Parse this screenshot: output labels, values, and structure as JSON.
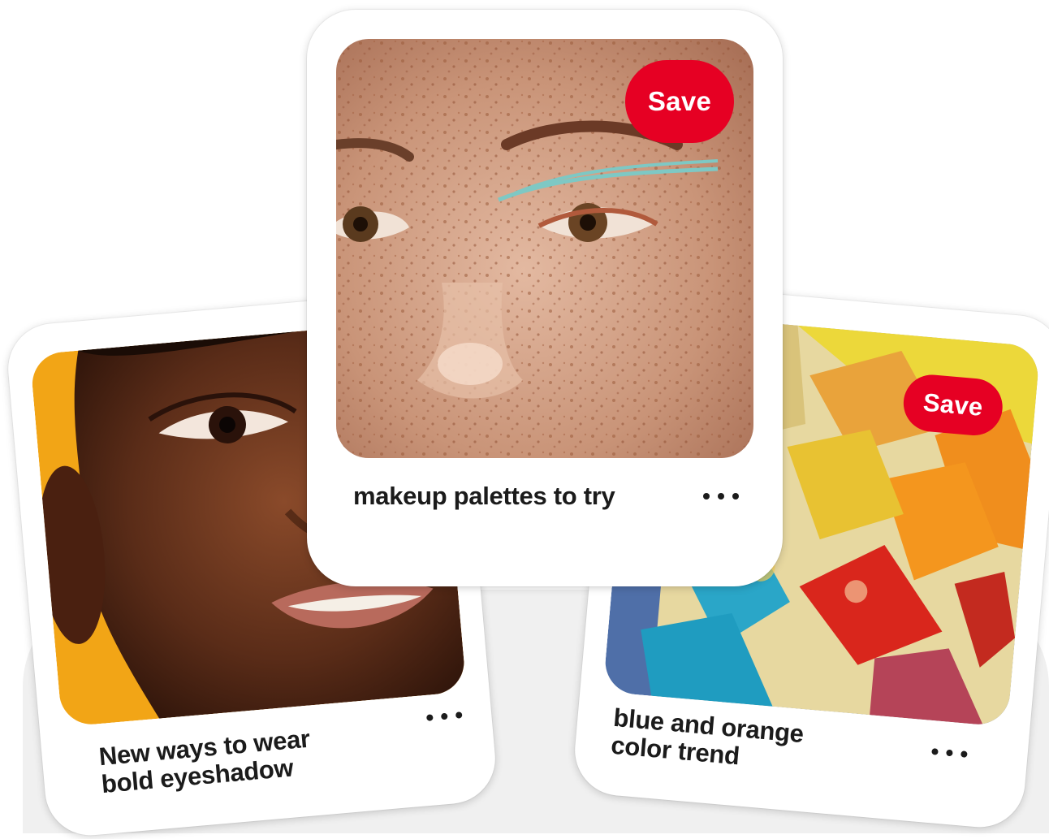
{
  "pins": {
    "left": {
      "title_line1": "New ways to wear",
      "title_line2": "bold eyeshadow",
      "more_icon": "more-horizontal-icon"
    },
    "center": {
      "title": "makeup palettes to try",
      "save_label": "Save",
      "more_icon": "more-horizontal-icon"
    },
    "right": {
      "title_line1": "blue and orange",
      "title_line2": "color trend",
      "save_label": "Save",
      "more_icon": "more-horizontal-icon"
    }
  },
  "colors": {
    "save_button": "#e60023",
    "text": "#1b1b1b",
    "background": "#ffffff",
    "backdrop": "#f0f0f0"
  }
}
